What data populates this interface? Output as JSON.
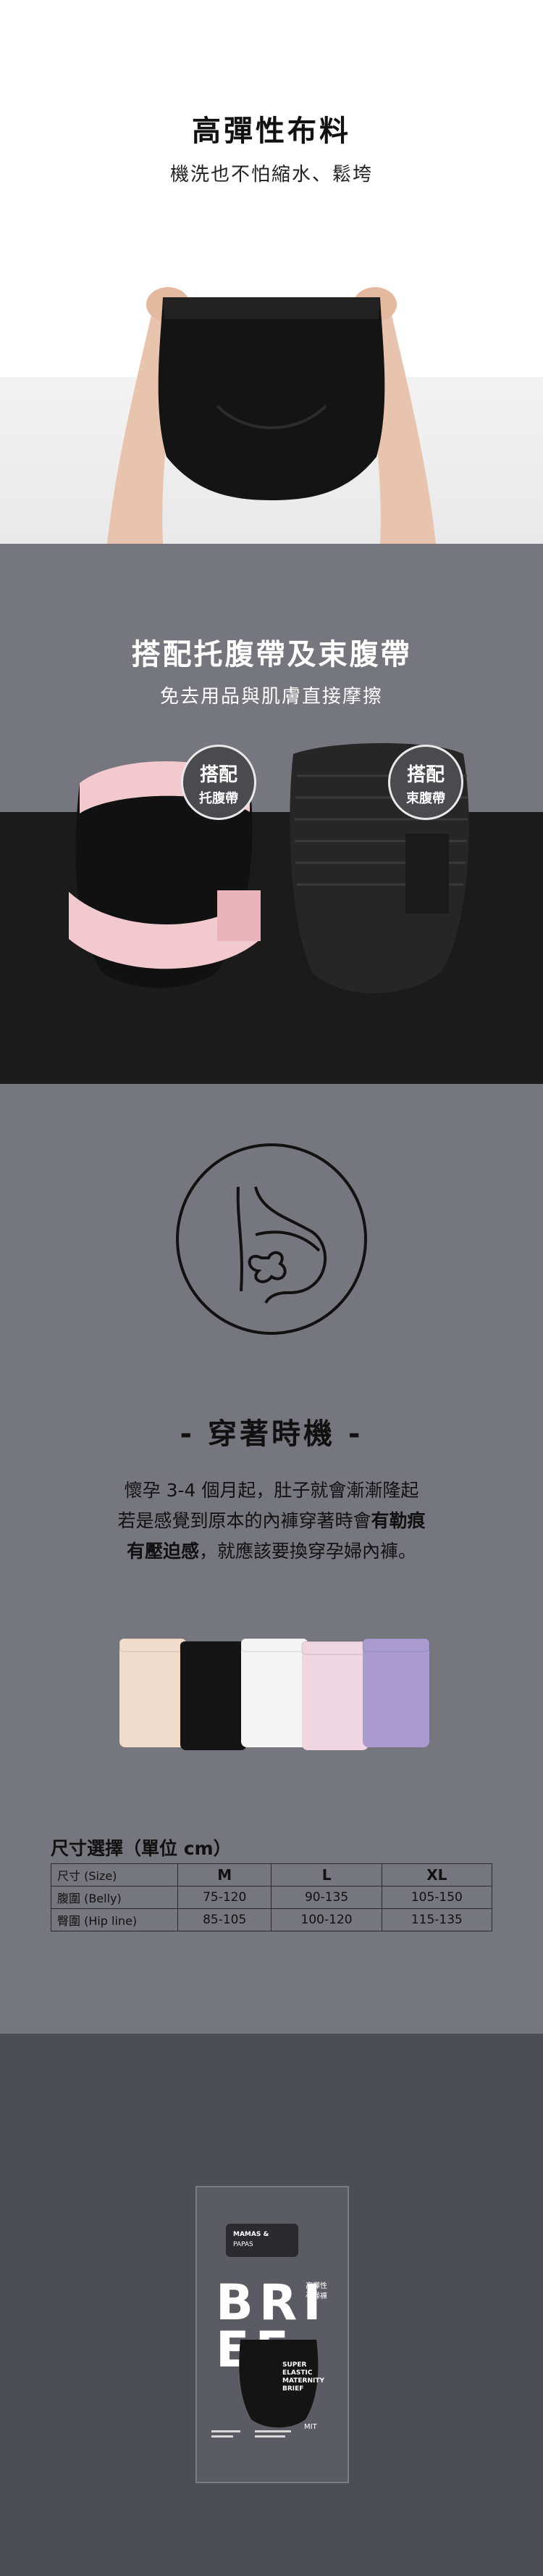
{
  "section1": {
    "title": "高彈性布料",
    "subtitle": "機洗也不怕縮水、鬆垮"
  },
  "section2": {
    "title_prefix": "搭配",
    "title_bold1": "托腹帶",
    "title_mid": "及",
    "title_bold2": "束腹帶",
    "subtitle": "免去用品與肌膚直接摩擦",
    "badge_left": {
      "line1": "搭配",
      "line2": "托腹帶"
    },
    "badge_right": {
      "line1": "搭配",
      "line2": "束腹帶"
    }
  },
  "section3": {
    "heading": "- 穿著時機 -",
    "para_line1": "懷孕 3-4 個月起，肚子就會漸漸隆起",
    "para_line2_a": "若是感覺到原本的內褲穿著時會",
    "para_line2_b": "有勒痕",
    "para_line3_a": "有壓迫感",
    "para_line3_b": "，就應該要換穿孕婦內褲。",
    "swatch_colors": [
      "#f0dccb",
      "#141414",
      "#f4f4f4",
      "#efd6e0",
      "#a99bd0"
    ],
    "size_table": {
      "title": "尺寸選擇（單位 cm）",
      "header": {
        "label": "尺寸 (Size)",
        "cols": [
          "M",
          "L",
          "XL"
        ]
      },
      "rows": [
        {
          "label": "腹圍 (Belly)",
          "values": [
            "75-120",
            "90-135",
            "105-150"
          ]
        },
        {
          "label": "臀圍 (Hip line)",
          "values": [
            "85-105",
            "100-120",
            "115-135"
          ]
        }
      ]
    }
  },
  "section4": {
    "logo_line1": "MAMAS &",
    "logo_line2": "PAPAS",
    "brand_word": "BRI",
    "brand_word2": "EF",
    "side_text_1": "高彈性",
    "side_text_2": "孕婦褲",
    "product_lines": [
      "SUPER",
      "ELASTIC",
      "MATERNITY",
      "BRIEF"
    ],
    "mit": "MIT"
  }
}
